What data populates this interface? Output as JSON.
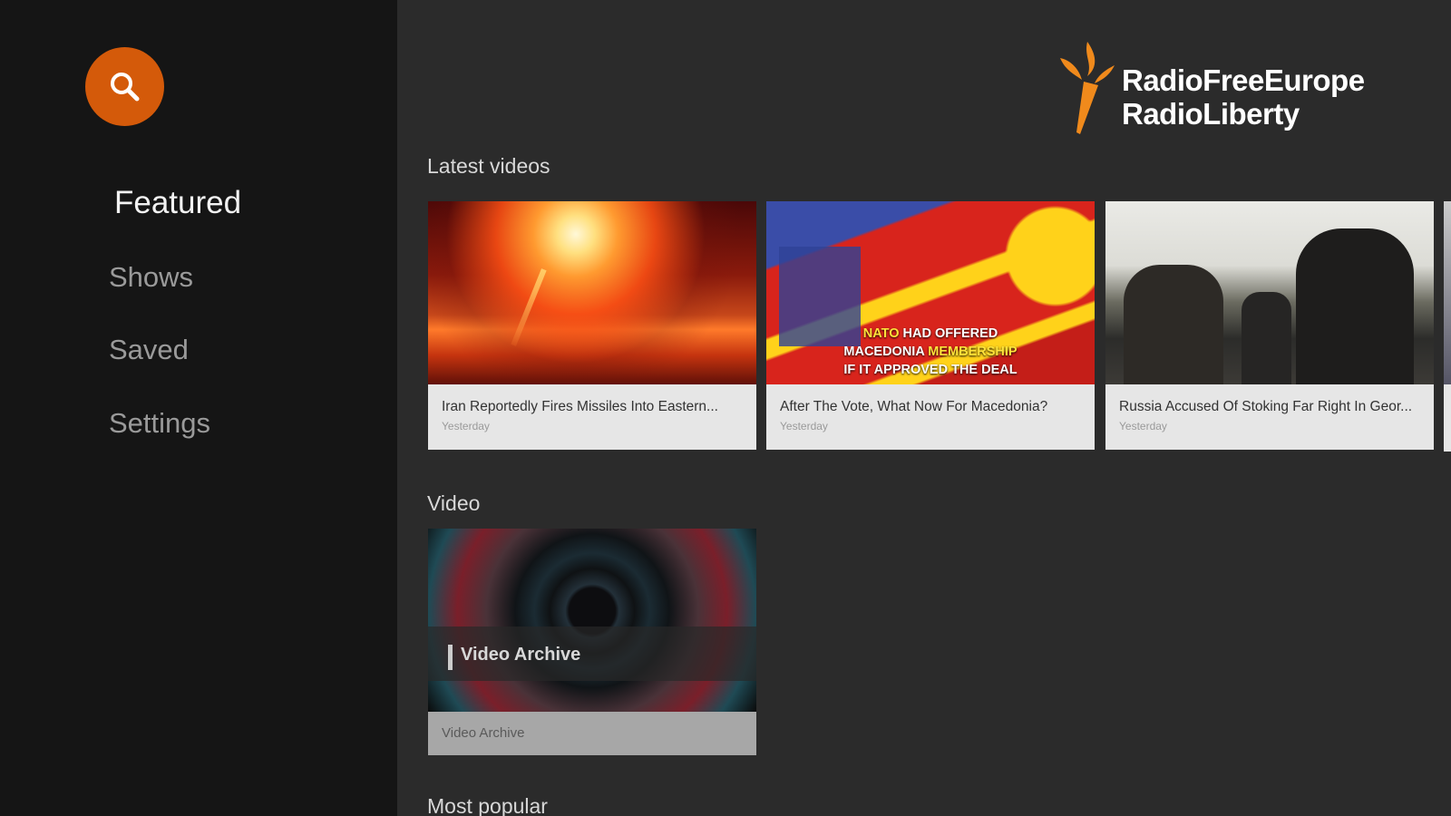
{
  "sidebar": {
    "search_icon": "search-icon",
    "nav": [
      {
        "label": "Featured",
        "active": true
      },
      {
        "label": "Shows",
        "active": false
      },
      {
        "label": "Saved",
        "active": false
      },
      {
        "label": "Settings",
        "active": false
      }
    ]
  },
  "header": {
    "logo_line1": "RadioFreeEurope",
    "logo_line2": "RadioLiberty",
    "logo_icon": "torch-logo-icon",
    "accent_color": "#d45a0a"
  },
  "sections": {
    "latest": {
      "title": "Latest videos",
      "cards": [
        {
          "title": "Iran Reportedly Fires Missiles Into Eastern...",
          "date": "Yesterday"
        },
        {
          "title": "After The Vote, What Now For Macedonia?",
          "date": "Yesterday",
          "overlay": {
            "line1a": "NATO",
            "line1b": " HAD OFFERED",
            "line2a": "MACEDONIA ",
            "line2b": "MEMBERSHIP",
            "line3": "IF IT APPROVED THE DEAL"
          }
        },
        {
          "title": "Russia Accused Of Stoking Far Right In Geor...",
          "date": "Yesterday"
        }
      ]
    },
    "video": {
      "title": "Video",
      "cards": [
        {
          "overlay": "Video Archive",
          "title": "Video Archive"
        }
      ]
    },
    "popular": {
      "title": "Most popular"
    }
  }
}
